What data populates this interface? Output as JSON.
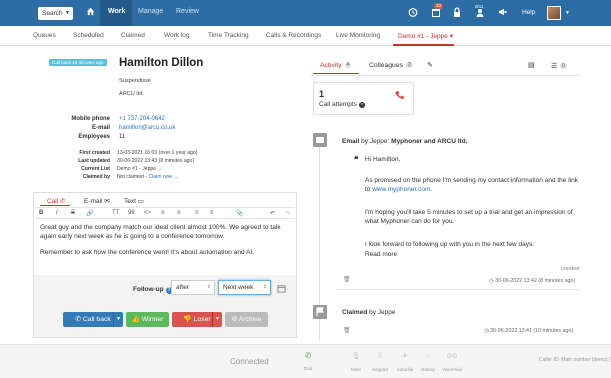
{
  "topbar": {
    "search_label": "Search",
    "nav": [
      "Work",
      "Manage",
      "Review"
    ],
    "notif_count": "33",
    "user_count": "8/11",
    "help": "Help"
  },
  "subnav": {
    "items": [
      "Queues",
      "Scheduled",
      "Claimed",
      "Work log",
      "Time Tracking",
      "Calls & Recordings",
      "Live Monitoring",
      "Demo #1 - Jeppe"
    ]
  },
  "contact": {
    "callback_pill": "Call back 19 minutes ago",
    "name": "Hamilton Dillon",
    "title": "Suspendisse",
    "company": "ARCU ltd.",
    "mobile_label": "Mobile phone",
    "mobile": "+1 737-204-0642",
    "email_label": "E-mail",
    "email": "hamilton@arcu.co.uk",
    "employees_label": "Employees",
    "employees": "11",
    "first_created_label": "First created",
    "first_created": "13-03-2021 16:03 (over 1 year ago)",
    "last_updated_label": "Last updated",
    "last_updated": "30-06-2022 13:43 (8 minutes ago)",
    "current_list_label": "Current List",
    "current_list": "Demo #1 - Jeppe",
    "claimed_by_label": "Claimed by",
    "claimed_by": "Not claimed",
    "claim_now": "Claim now"
  },
  "editor": {
    "tabs": [
      "Call",
      "E-mail",
      "Text"
    ],
    "toolbar": [
      "B",
      "I",
      "S",
      "🔗",
      "TT",
      "99",
      "<>",
      "≡",
      "≡",
      "≡",
      "≡",
      "📎",
      "↶",
      "↷"
    ],
    "text1": "Great guy and the company match our ideal client almost 100%. We agreed to talk again early next week as he is going to a conference tomorrow.",
    "text2": "Remember to ask how the conference went! It's about automation and AI.",
    "followup_label": "Follow-up",
    "followup_when": "after",
    "followup_value": "Next week",
    "btn_callback": "Call back",
    "btn_winner": "Winner",
    "btn_loser": "Loser",
    "btn_archive": "Archive"
  },
  "activity": {
    "tab_activity": "Activity",
    "activity_count": "4",
    "tab_colleagues": "Colleagues",
    "colleagues_count": "2",
    "list_count": "0",
    "attempts_num": "1",
    "attempts_label": "Call attempts",
    "email_head_pre": "Email",
    "email_head_by": "by Jeppe:",
    "email_head_subject": "Myphoner and ARCU ltd.",
    "greeting": "Hi Hamilton,",
    "p1a": "As promised on the phone I'm sending my contact information and the link to",
    "p1_link": "www.myphoner.com",
    "p2": "I'm hoping you'll take 5 minutes to set up a trial and get an impression of what Myphoner can do for you.",
    "p3": "I look forward to following up with you in the next few days.",
    "read_more": "Read more",
    "created": "created",
    "ts1": "30-06-2022 13:42 (8 minutes ago)",
    "claimed_head": "Claimed",
    "claimed_by": "by Jeppe",
    "ts2": "30-06-2022 13:41 (10 minutes ago)"
  },
  "bottombar": {
    "status": "Connected",
    "dial": "Dial",
    "mute": "Mute",
    "keypad": "Keypad",
    "autodial": "Autodial",
    "rating": "Rating",
    "voicemail": "Voicemail",
    "caller_id": "Caller ID: Main number (demo) (+45 7"
  },
  "colors": {
    "primary": "#2e6da4",
    "accent_red": "#c9302c",
    "callback": "#337ab7",
    "winner": "#5cb85c",
    "loser": "#d9534f",
    "archive": "#bbbbbb"
  }
}
